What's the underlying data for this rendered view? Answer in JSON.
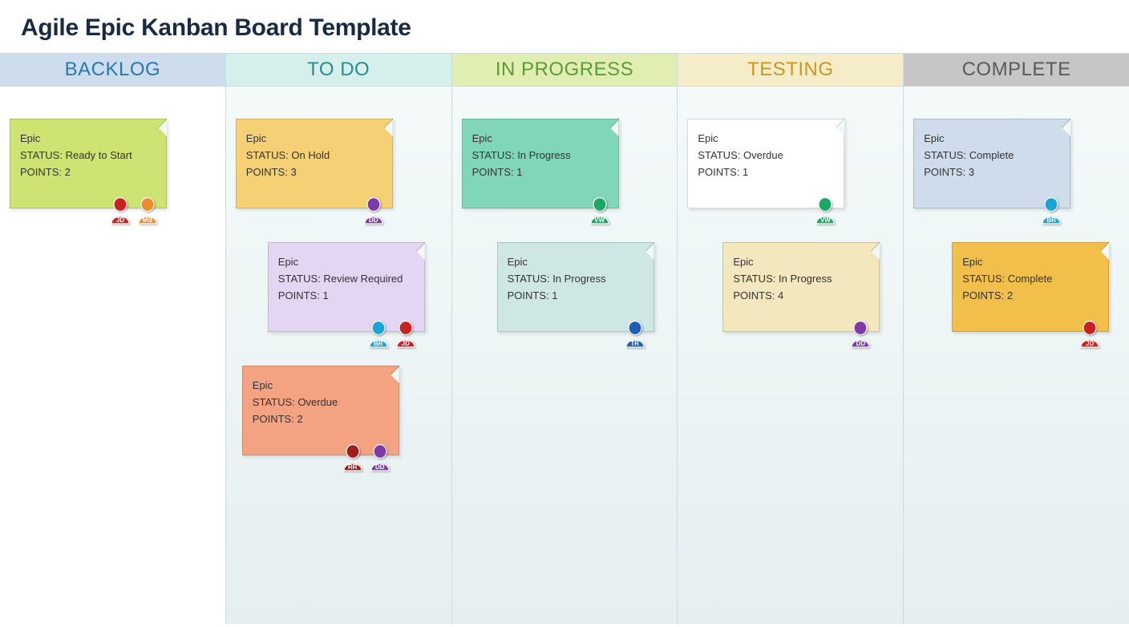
{
  "title": "Agile Epic Kanban Board Template",
  "labels": {
    "status": "STATUS",
    "points": "POINTS"
  },
  "avatar_colors": {
    "JD": "#c72323",
    "MB": "#ee8b2c",
    "DD": "#7e3aa8",
    "BR": "#1aa5d6",
    "RR": "#9e1f1f",
    "VW": "#1da764",
    "TR": "#1e5fb3"
  },
  "columns": [
    {
      "name": "BACKLOG",
      "header_bg": "#cdddee",
      "header_color": "#2a77af",
      "cards": [
        {
          "title": "Epic",
          "status": "Ready to Start",
          "points": 2,
          "bg": "#cde472",
          "avatars": [
            "JD",
            "MB"
          ],
          "offset": 0
        }
      ]
    },
    {
      "name": "TO DO",
      "header_bg": "#d5f0ea",
      "header_color": "#2a8b92",
      "cards": [
        {
          "title": "Epic",
          "status": "On Hold",
          "points": 3,
          "bg": "#f5d074",
          "avatars": [
            "DD"
          ],
          "offset": 0
        },
        {
          "title": "Epic",
          "status": "Review Required",
          "points": 1,
          "bg": "#e4d6f2",
          "avatars": [
            "BR",
            "JD"
          ],
          "offset": 40
        },
        {
          "title": "Epic",
          "status": "Overdue",
          "points": 2,
          "bg": "#f3a382",
          "avatars": [
            "RR",
            "DD"
          ],
          "offset": 8
        }
      ]
    },
    {
      "name": "IN PROGRESS",
      "header_bg": "#e0efb1",
      "header_color": "#5d9b3a",
      "cards": [
        {
          "title": "Epic",
          "status": "In Progress",
          "points": 1,
          "bg": "#7fd7b7",
          "avatars": [
            "VW"
          ],
          "offset": 0
        },
        {
          "title": "Epic",
          "status": "In Progress",
          "points": 1,
          "bg": "#cfe7e4",
          "avatars": [
            "TR"
          ],
          "offset": 44
        }
      ]
    },
    {
      "name": "TESTING",
      "header_bg": "#f5edc7",
      "header_color": "#cc9720",
      "cards": [
        {
          "title": "Epic",
          "status": "Overdue",
          "points": 1,
          "bg": "#ffffff",
          "avatars": [
            "VW"
          ],
          "offset": 0
        },
        {
          "title": "Epic",
          "status": "In Progress",
          "points": 4,
          "bg": "#f2e7bd",
          "avatars": [
            "DD"
          ],
          "offset": 44
        }
      ]
    },
    {
      "name": "COMPLETE",
      "header_bg": "#c6c6c6",
      "header_color": "#5a5a5a",
      "cards": [
        {
          "title": "Epic",
          "status": "Complete",
          "points": 3,
          "bg": "#cedceb",
          "avatars": [
            "BR"
          ],
          "offset": 0
        },
        {
          "title": "Epic",
          "status": "Complete",
          "points": 2,
          "bg": "#f2c04a",
          "avatars": [
            "JD"
          ],
          "offset": 48
        }
      ]
    }
  ]
}
